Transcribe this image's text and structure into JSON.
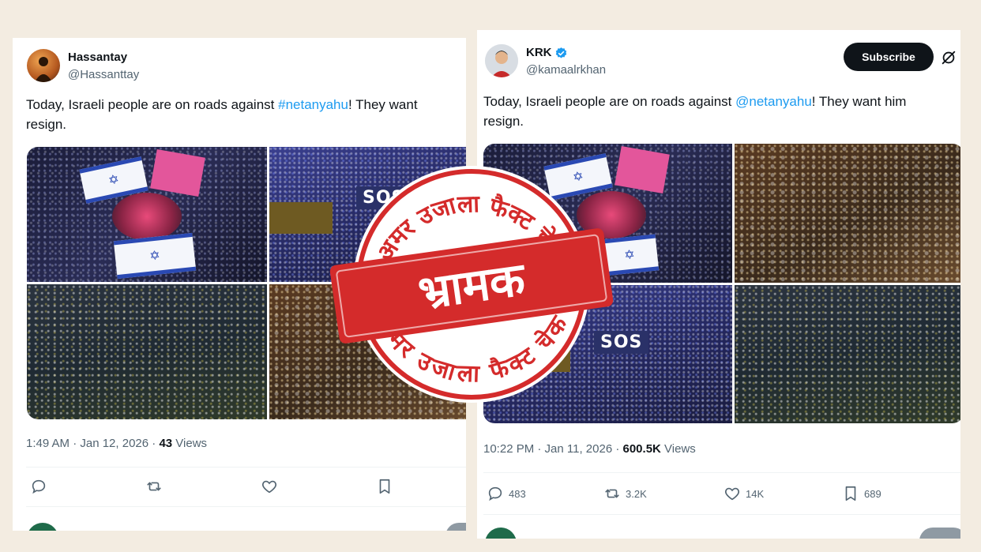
{
  "left_tweet": {
    "name": "Hassantay",
    "handle": "@Hassanttay",
    "text_before": "Today, Israeli people are on roads against ",
    "hashtag": "#netanyahu",
    "text_after": "! They want",
    "text_line2": "resign.",
    "meta_time": "1:49 AM · Jan 12, 2026 · ",
    "meta_views_count": "43",
    "meta_views_label": " Views",
    "icons": [
      "reply-icon",
      "retweet-icon",
      "like-icon",
      "bookmark-icon"
    ]
  },
  "right_tweet": {
    "name": "KRK",
    "handle": "@kamaalrkhan",
    "subscribe_label": "Subscribe",
    "text_before": "Today, Israeli people are on roads against ",
    "mention": "@netanyahu",
    "text_after": "! They want him",
    "text_line2": "resign.",
    "meta_time": "10:22 PM · Jan 11, 2026 · ",
    "meta_views_count": "600.5K",
    "meta_views_label": " Views",
    "reply_count": "483",
    "retweet_count": "3.2K",
    "like_count": "14K",
    "bookmark_count": "689",
    "sos_sign": "SOS"
  },
  "stamp": {
    "arc_top": "अमर उजाला फैक्ट चेक",
    "arc_bottom": "अमर उजाला फैक्ट चेक",
    "verdict": "भ्रामक",
    "color": "#d42b2b"
  }
}
